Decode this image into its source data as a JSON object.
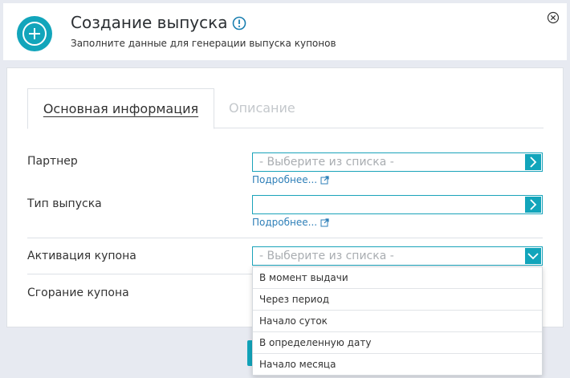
{
  "header": {
    "title": "Создание выпуска",
    "subtitle": "Заполните данные для генерации выпуска купонов",
    "add_icon": "plus-circle-icon",
    "info_icon": "info-icon",
    "close_icon": "close-icon"
  },
  "tabs": [
    {
      "label": "Основная информация",
      "active": true
    },
    {
      "label": "Описание",
      "active": false
    }
  ],
  "form": {
    "partner": {
      "label": "Партнер",
      "value": "",
      "placeholder": "- Выберите из списка -",
      "more_link": "Подробнее..."
    },
    "issue_type": {
      "label": "Тип выпуска",
      "value": "",
      "placeholder": "",
      "more_link": "Подробнее..."
    },
    "coupon_activation": {
      "label": "Активация купона",
      "value": "- Выберите из списка -",
      "options": [
        "В момент выдачи",
        "Через период",
        "Начало суток",
        "В определенную дату",
        "Начало месяца"
      ]
    },
    "coupon_expiry": {
      "label": "Сгорание купона"
    }
  },
  "colors": {
    "accent": "#12a5bb",
    "link": "#2e7fb8",
    "background": "#e7eaf1"
  }
}
